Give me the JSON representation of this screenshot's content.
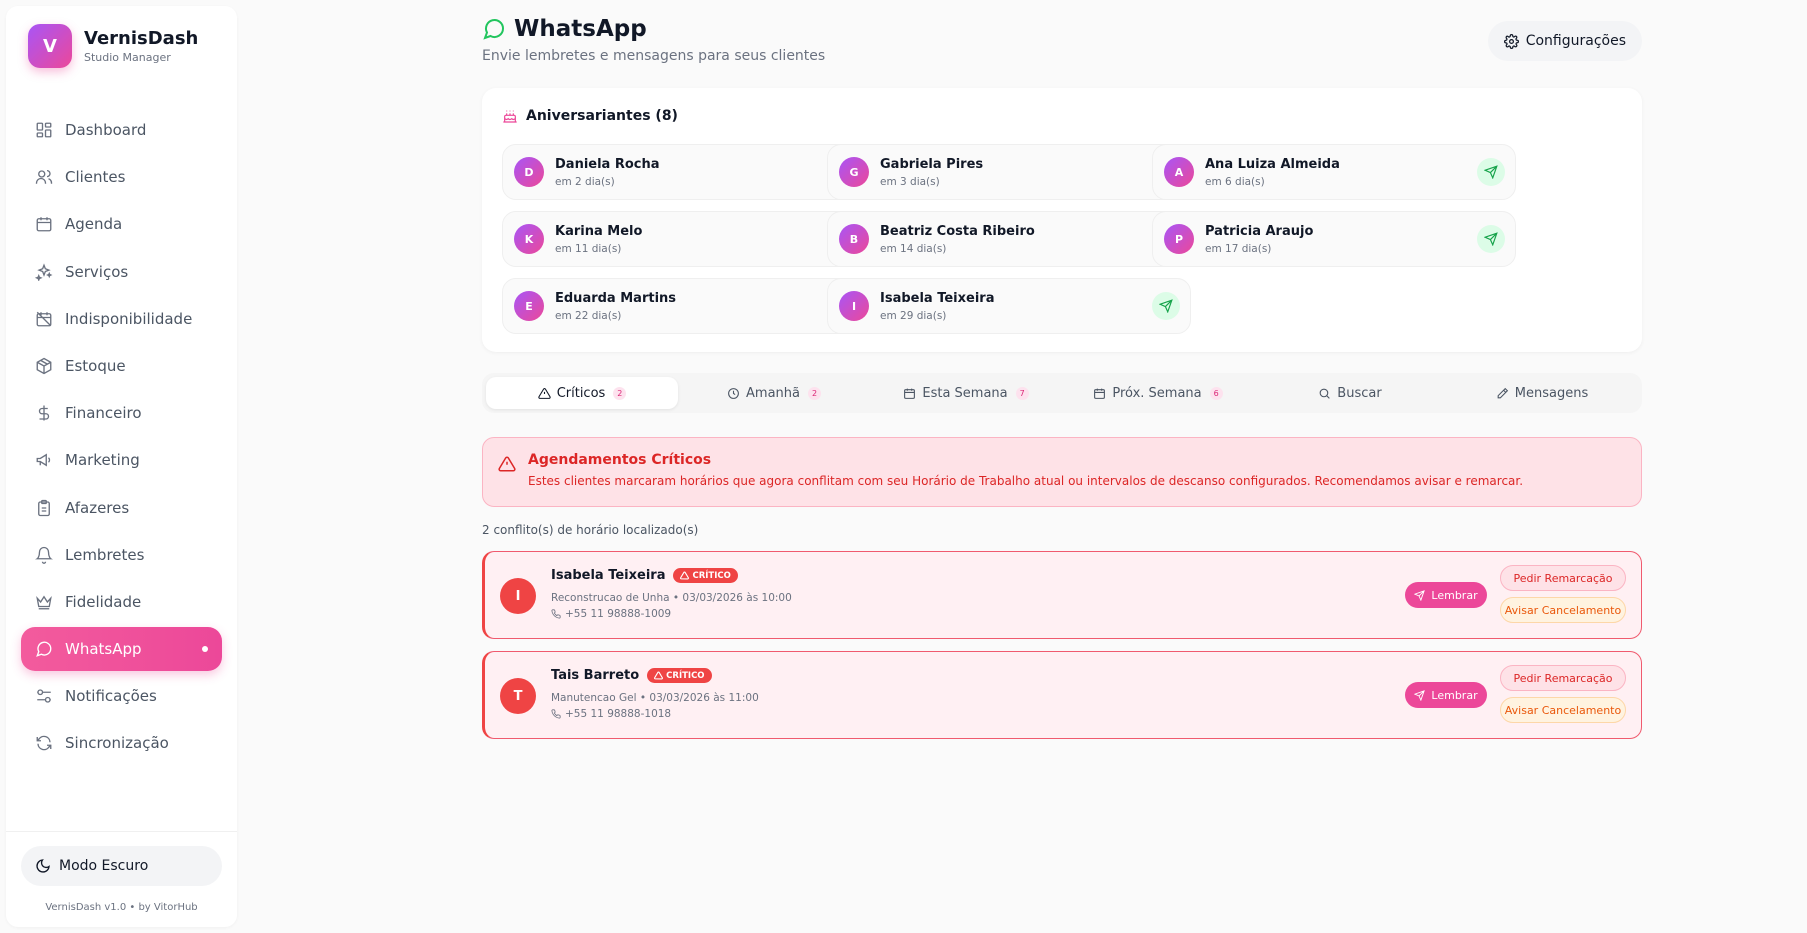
{
  "brand": {
    "logo_letter": "V",
    "name": "VernisDash",
    "subtitle": "Studio Manager"
  },
  "sidebar": {
    "items": [
      {
        "label": "Dashboard",
        "icon": "grid-icon"
      },
      {
        "label": "Clientes",
        "icon": "users-icon"
      },
      {
        "label": "Agenda",
        "icon": "calendar-icon"
      },
      {
        "label": "Serviços",
        "icon": "sparkles-icon"
      },
      {
        "label": "Indisponibilidade",
        "icon": "calendar-off-icon"
      },
      {
        "label": "Estoque",
        "icon": "package-icon"
      },
      {
        "label": "Financeiro",
        "icon": "dollar-icon"
      },
      {
        "label": "Marketing",
        "icon": "megaphone-icon"
      },
      {
        "label": "Afazeres",
        "icon": "clipboard-icon"
      },
      {
        "label": "Lembretes",
        "icon": "bell-icon"
      },
      {
        "label": "Fidelidade",
        "icon": "crown-icon"
      },
      {
        "label": "WhatsApp",
        "icon": "message-circle-icon",
        "active": true
      },
      {
        "label": "Notificações",
        "icon": "sliders-icon"
      },
      {
        "label": "Sincronização",
        "icon": "refresh-icon"
      }
    ],
    "dark_mode_label": "Modo Escuro",
    "version": "VernisDash v1.0 • by VitorHub"
  },
  "header": {
    "title": "WhatsApp",
    "subtitle": "Envie lembretes e mensagens para seus clientes",
    "config_label": "Configurações"
  },
  "birthdays": {
    "title": "Aniversariantes (8)",
    "items": [
      {
        "initial": "D",
        "name": "Daniela Rocha",
        "days": "em 2 dia(s)"
      },
      {
        "initial": "G",
        "name": "Gabriela Pires",
        "days": "em 3 dia(s)"
      },
      {
        "initial": "A",
        "name": "Ana Luiza Almeida",
        "days": "em 6 dia(s)"
      },
      {
        "initial": "K",
        "name": "Karina Melo",
        "days": "em 11 dia(s)"
      },
      {
        "initial": "B",
        "name": "Beatriz Costa Ribeiro",
        "days": "em 14 dia(s)"
      },
      {
        "initial": "P",
        "name": "Patricia Araujo",
        "days": "em 17 dia(s)"
      },
      {
        "initial": "E",
        "name": "Eduarda Martins",
        "days": "em 22 dia(s)"
      },
      {
        "initial": "I",
        "name": "Isabela Teixeira",
        "days": "em 29 dia(s)"
      }
    ]
  },
  "tabs": [
    {
      "label": "Críticos",
      "count": "2",
      "icon": "alert-triangle-icon",
      "active": true
    },
    {
      "label": "Amanhã",
      "count": "2",
      "icon": "clock-icon"
    },
    {
      "label": "Esta Semana",
      "count": "7",
      "icon": "calendar-icon"
    },
    {
      "label": "Próx. Semana",
      "count": "6",
      "icon": "calendar-icon"
    },
    {
      "label": "Buscar",
      "count": "",
      "icon": "search-icon"
    },
    {
      "label": "Mensagens",
      "count": "",
      "icon": "pencil-icon"
    }
  ],
  "alert": {
    "title": "Agendamentos Críticos",
    "text": "Estes clientes marcaram horários que agora conflitam com seu Horário de Trabalho atual ou intervalos de descanso configurados. Recomendamos avisar e remarcar."
  },
  "conflicts_text": "2 conflito(s) de horário localizado(s)",
  "critical": {
    "badge_label": "CRÍTICO",
    "remind_label": "Lembrar",
    "reschedule_label": "Pedir Remarcação",
    "cancel_label": "Avisar Cancelamento",
    "items": [
      {
        "initial": "I",
        "name": "Isabela Teixeira",
        "service": "Reconstrucao de Unha • 03/03/2026 às 10:00",
        "phone": "+55 11 98888-1009"
      },
      {
        "initial": "T",
        "name": "Tais Barreto",
        "service": "Manutencao Gel • 03/03/2026 às 11:00",
        "phone": "+55 11 98888-1018"
      }
    ]
  },
  "colors": {
    "accent": "#ec4899",
    "critical": "#ef4444",
    "whatsapp": "#22c55e"
  }
}
